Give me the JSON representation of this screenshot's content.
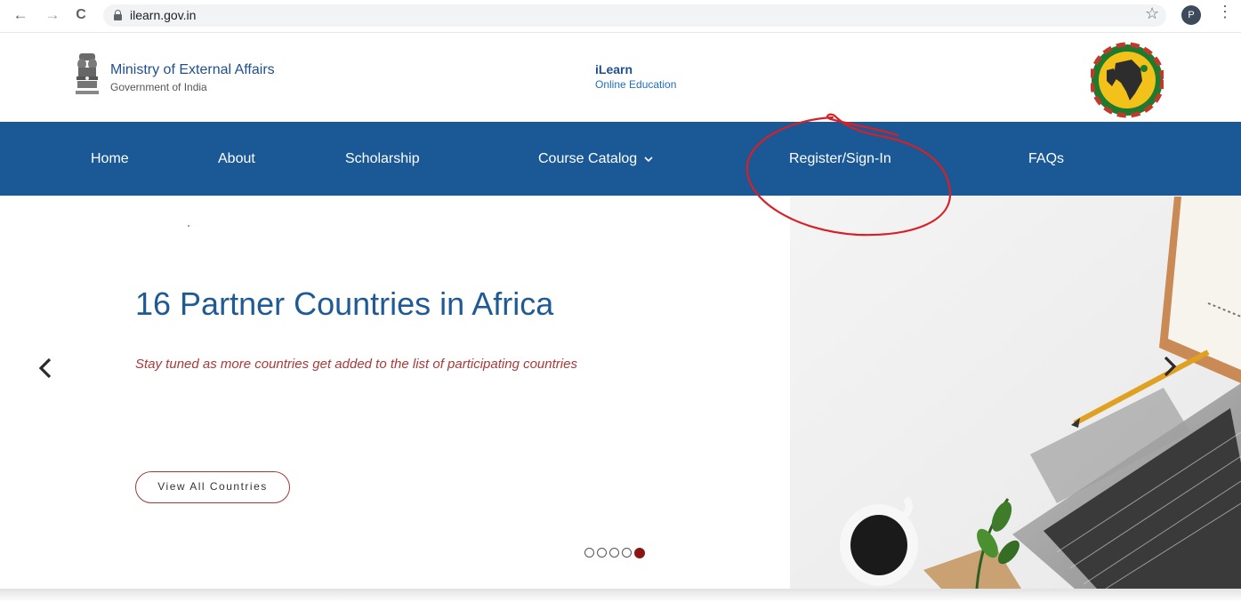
{
  "browser": {
    "url": "ilearn.gov.in",
    "back_glyph": "←",
    "forward_glyph": "→",
    "reload_glyph": "C",
    "star_glyph": "☆",
    "profile_initial": "P",
    "menu_glyph": "⋮"
  },
  "header": {
    "ministry_name": "Ministry of External Affairs",
    "ministry_sub": "Government of India",
    "site_name": "iLearn",
    "site_tagline": "Online Education"
  },
  "nav": {
    "items": [
      {
        "label": "Home"
      },
      {
        "label": "About"
      },
      {
        "label": "Scholarship"
      },
      {
        "label": "Course Catalog"
      },
      {
        "label": "Register/Sign-In"
      },
      {
        "label": "FAQs"
      }
    ]
  },
  "hero": {
    "title": "16 Partner Countries in Africa",
    "subtitle": "Stay tuned as more countries get added to the list of participating countries",
    "button_label": "View All Countries",
    "slides_total": 5,
    "active_slide": 5
  },
  "colors": {
    "nav_bg": "#1a5896",
    "title_blue": "#1f5a94",
    "accent_red": "#a33a3a",
    "indicator_active": "#8b1515",
    "annotation_red": "#d81f26"
  },
  "icons": {
    "lock": "lock-icon",
    "dropdown": "chevron-down-icon",
    "prev": "chevron-left-icon",
    "next": "chevron-right-icon"
  }
}
